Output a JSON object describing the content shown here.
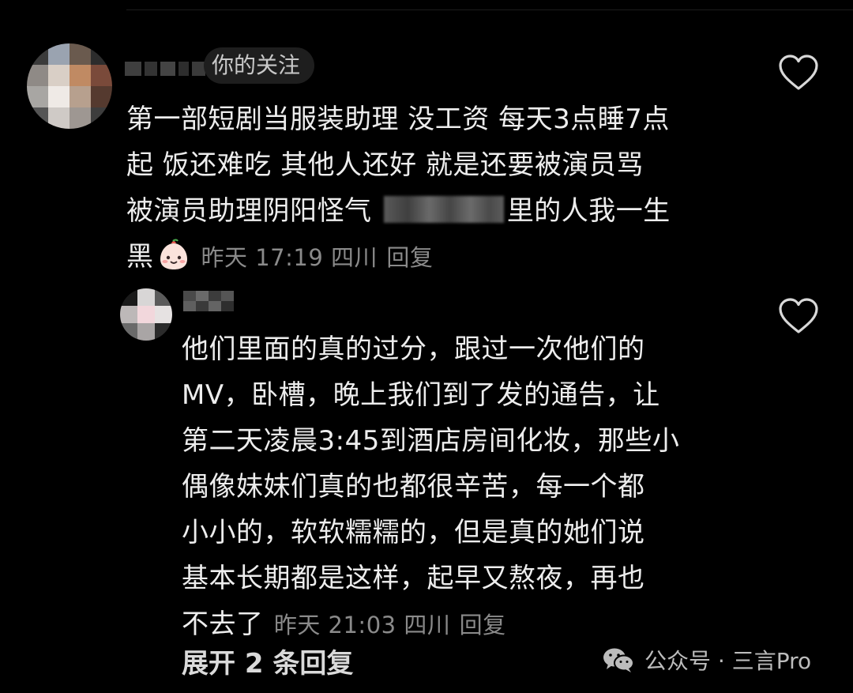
{
  "comment_1": {
    "follow_badge": "你的关注",
    "line_1": "第一部短剧当服装助理 没工资 每天3点睡7点",
    "line_2": "起 饭还难吃 其他人还好 就是还要被演员骂",
    "line_3_before": "被演员助理阴阳怪气 ",
    "line_3_after": "里的人我一生",
    "line_4": "黑",
    "meta": "昨天 17:19 四川",
    "reply_label": "回复",
    "emoji_icon": "steamed-bun-face-emoji"
  },
  "comment_2": {
    "lines": [
      "他们里面的真的过分，跟过一次他们的",
      "MV，卧槽，晚上我们到了发的通告，让",
      "第二天凌晨3:45到酒店房间化妆，那些小",
      "偶像妹妹们真的也都很辛苦，每一个都",
      "小小的，软软糯糯的，但是真的她们说",
      "基本长期都是这样，起早又熬夜，再也"
    ],
    "last_line": "不去了",
    "meta": "昨天 21:03 四川",
    "reply_label": "回复"
  },
  "expand_replies": "展开 2 条回复",
  "watermark": {
    "text": "公众号 · 三言Pro",
    "icon": "wechat-icon"
  },
  "icons": {
    "like_icon": "heart-outline-icon"
  },
  "colors": {
    "background": "#000000",
    "text_primary": "#ededed",
    "text_secondary": "#8a8a8a",
    "badge_bg": "#1e1e1e"
  }
}
